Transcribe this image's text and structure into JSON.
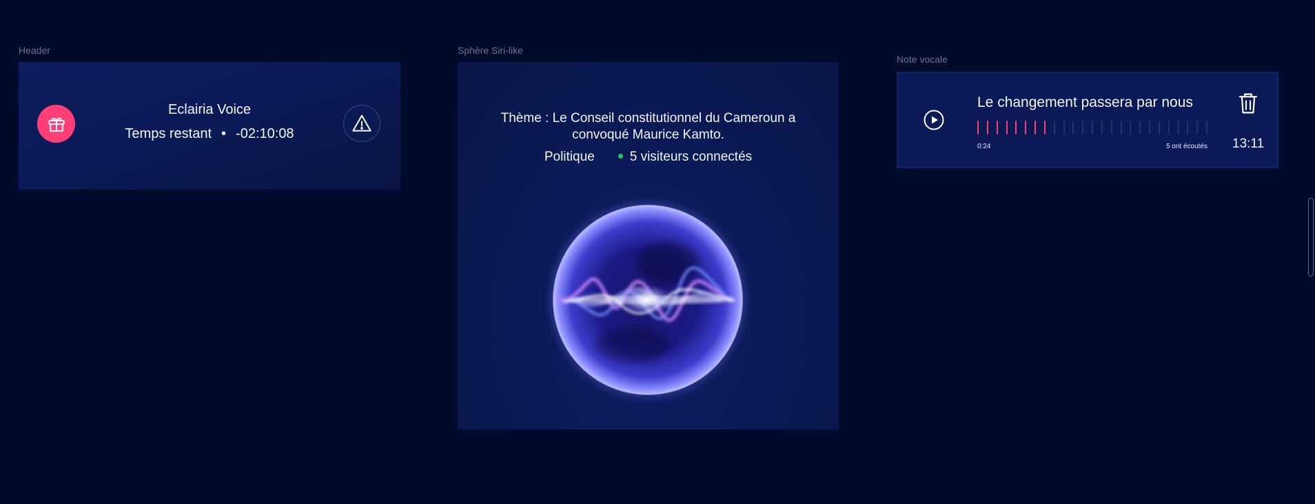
{
  "labels": {
    "header": "Header",
    "sphere": "Sphère Siri-like",
    "note": "Note vocale"
  },
  "header": {
    "title": "Eclairia Voice",
    "remaining_label": "Temps restant",
    "separator": "•",
    "remaining_time": "-02:10:08",
    "gift_icon": "gift-icon",
    "warning_icon": "warning-triangle-icon",
    "accent": "#ff3f76"
  },
  "sphere": {
    "theme": "Thème : Le Conseil constitutionnel du Cameroun a convoqué Maurice Kamto.",
    "category": "Politique",
    "visitors": "5 visiteurs connectés",
    "online_color": "#22c55e"
  },
  "note": {
    "title": "Le changement passera par nous",
    "current_time": "0:24",
    "listens": "5 ont écoutés",
    "time": "13:11",
    "progress_bars_played": 8,
    "progress_bars_total": 25,
    "played_color": "#ff3f76",
    "unplayed_color": "#26336b",
    "play_icon": "play-icon",
    "delete_icon": "trash-icon"
  }
}
